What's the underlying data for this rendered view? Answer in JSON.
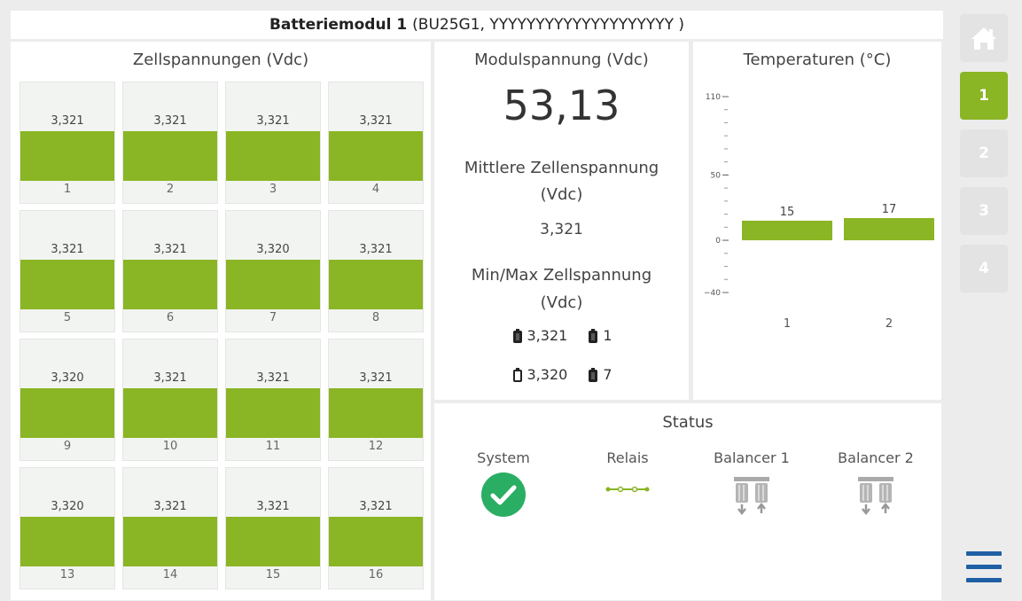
{
  "header": {
    "title": "Batteriemodul 1",
    "subtitle": "(BU25G1, YYYYYYYYYYYYYYYYYYYY )"
  },
  "cells": {
    "title": "Zellspannungen (Vdc)",
    "items": [
      {
        "value": "3,321",
        "label": "1"
      },
      {
        "value": "3,321",
        "label": "2"
      },
      {
        "value": "3,321",
        "label": "3"
      },
      {
        "value": "3,321",
        "label": "4"
      },
      {
        "value": "3,321",
        "label": "5"
      },
      {
        "value": "3,321",
        "label": "6"
      },
      {
        "value": "3,320",
        "label": "7"
      },
      {
        "value": "3,321",
        "label": "8"
      },
      {
        "value": "3,320",
        "label": "9"
      },
      {
        "value": "3,321",
        "label": "10"
      },
      {
        "value": "3,321",
        "label": "11"
      },
      {
        "value": "3,321",
        "label": "12"
      },
      {
        "value": "3,320",
        "label": "13"
      },
      {
        "value": "3,321",
        "label": "14"
      },
      {
        "value": "3,321",
        "label": "15"
      },
      {
        "value": "3,321",
        "label": "16"
      }
    ]
  },
  "module": {
    "title": "Modulspannung (Vdc)",
    "voltage": "53,13",
    "avg_title_line1": "Mittlere Zellenspannung",
    "avg_title_line2": "(Vdc)",
    "avg_value": "3,321",
    "minmax_title_line1": "Min/Max Zellspannung",
    "minmax_title_line2": "(Vdc)",
    "max_value": "3,321",
    "max_cell": "1",
    "min_value": "3,320",
    "min_cell": "7"
  },
  "temperature": {
    "title": "Temperaturen (°C)",
    "chart_data": {
      "type": "bar",
      "categories": [
        "1",
        "2"
      ],
      "values": [
        15,
        17
      ],
      "ylim": [
        -40,
        110
      ],
      "yticks": [
        110,
        50,
        0,
        -40
      ],
      "ytick_labels": [
        "110",
        "50",
        "0",
        "−40"
      ],
      "color": "#8ab524"
    }
  },
  "status": {
    "title": "Status",
    "items": [
      {
        "label": "System",
        "icon": "check-circle-icon"
      },
      {
        "label": "Relais",
        "icon": "relay-closed-icon"
      },
      {
        "label": "Balancer 1",
        "icon": "balancer-icon"
      },
      {
        "label": "Balancer 2",
        "icon": "balancer-icon"
      }
    ]
  },
  "sidebar": {
    "home_icon": "home-icon",
    "modules": [
      "1",
      "2",
      "3",
      "4"
    ],
    "active_module": "1",
    "menu_icon": "hamburger-menu-icon",
    "accent": "#8ab524",
    "menu_color": "#1e5fa3"
  }
}
